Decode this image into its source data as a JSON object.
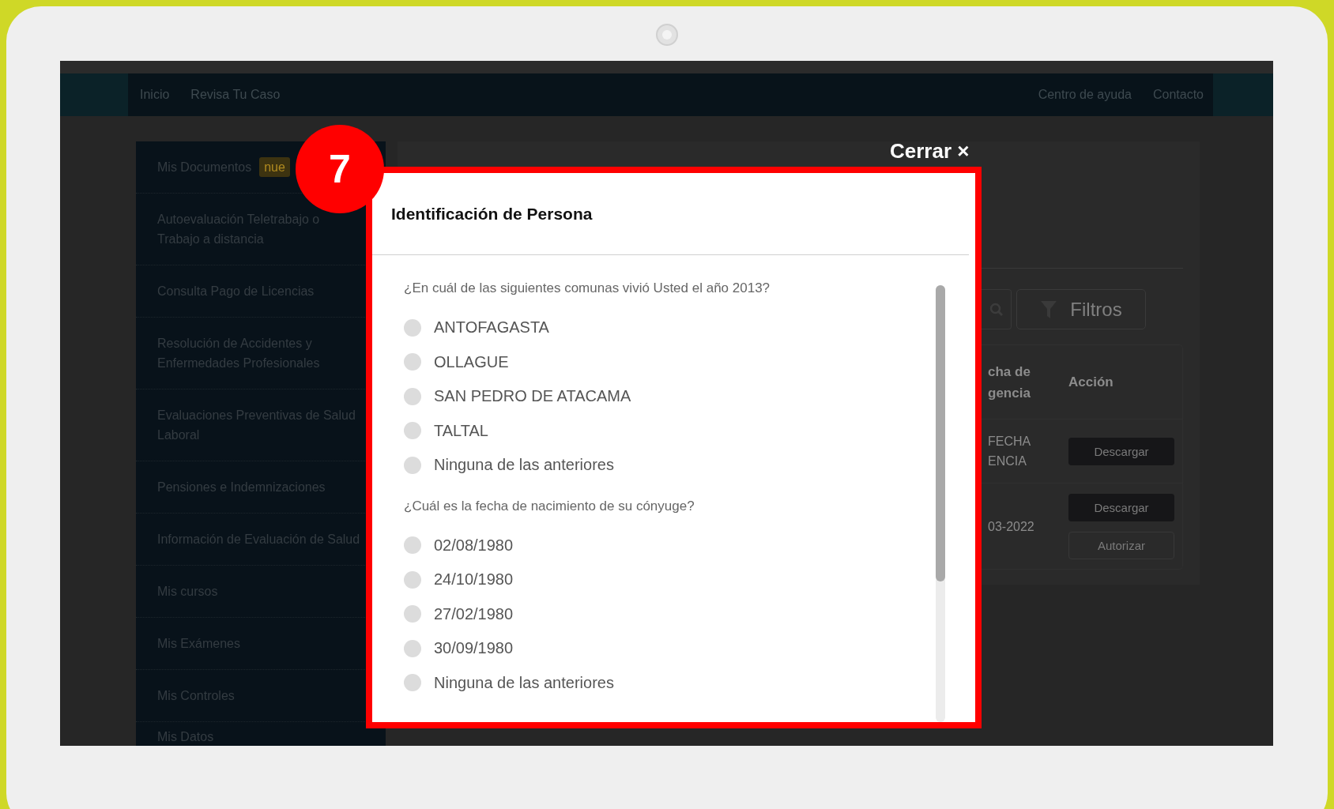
{
  "nav": {
    "left": [
      {
        "label": "Inicio"
      },
      {
        "label": "Revisa Tu Caso"
      }
    ],
    "right": [
      {
        "label": "Centro de ayuda"
      },
      {
        "label": "Contacto"
      }
    ]
  },
  "sidebar": {
    "items": [
      {
        "label": "Mis Documentos",
        "badge": "nue"
      },
      {
        "label": "Autoevaluación Teletrabajo o Trabajo a distancia"
      },
      {
        "label": "Consulta Pago de Licencias"
      },
      {
        "label": "Resolución de Accidentes y Enfermedades Profesionales"
      },
      {
        "label": "Evaluaciones Preventivas de Salud Laboral"
      },
      {
        "label": "Pensiones e Indemnizaciones"
      },
      {
        "label": "Información de Evaluación de Salud"
      },
      {
        "label": "Mis cursos"
      },
      {
        "label": "Mis Exámenes"
      },
      {
        "label": "Mis Controles"
      },
      {
        "label": "Mis Datos"
      }
    ]
  },
  "main": {
    "filter_button": {
      "label": "Filtros"
    },
    "table": {
      "columns": [
        "cha de gencia",
        "Acción"
      ],
      "rows": [
        {
          "column_1": "FECHA ENCIA",
          "actions": [
            "Descargar"
          ]
        },
        {
          "column_1": "03-2022",
          "actions": [
            "Descargar",
            "Autorizar"
          ]
        }
      ]
    }
  },
  "step_marker": "7",
  "close_button": {
    "label": "Cerrar ×"
  },
  "modal": {
    "title": "Identificación de Persona",
    "questions": [
      {
        "text": "¿En cuál de las siguientes comunas vivió Usted el año 2013?",
        "options": [
          {
            "label": "ANTOFAGASTA",
            "selected": false
          },
          {
            "label": "OLLAGUE",
            "selected": false
          },
          {
            "label": "SAN PEDRO DE ATACAMA",
            "selected": false
          },
          {
            "label": "TALTAL",
            "selected": false
          },
          {
            "label": "Ninguna de las anteriores",
            "selected": false
          }
        ]
      },
      {
        "text": "¿Cuál es la fecha de nacimiento de su cónyuge?",
        "options": [
          {
            "label": "02/08/1980",
            "selected": false
          },
          {
            "label": "24/10/1980",
            "selected": false
          },
          {
            "label": "27/02/1980",
            "selected": false
          },
          {
            "label": "30/09/1980",
            "selected": false
          },
          {
            "label": "Ninguna de las anteriores",
            "selected": false
          }
        ]
      }
    ]
  }
}
